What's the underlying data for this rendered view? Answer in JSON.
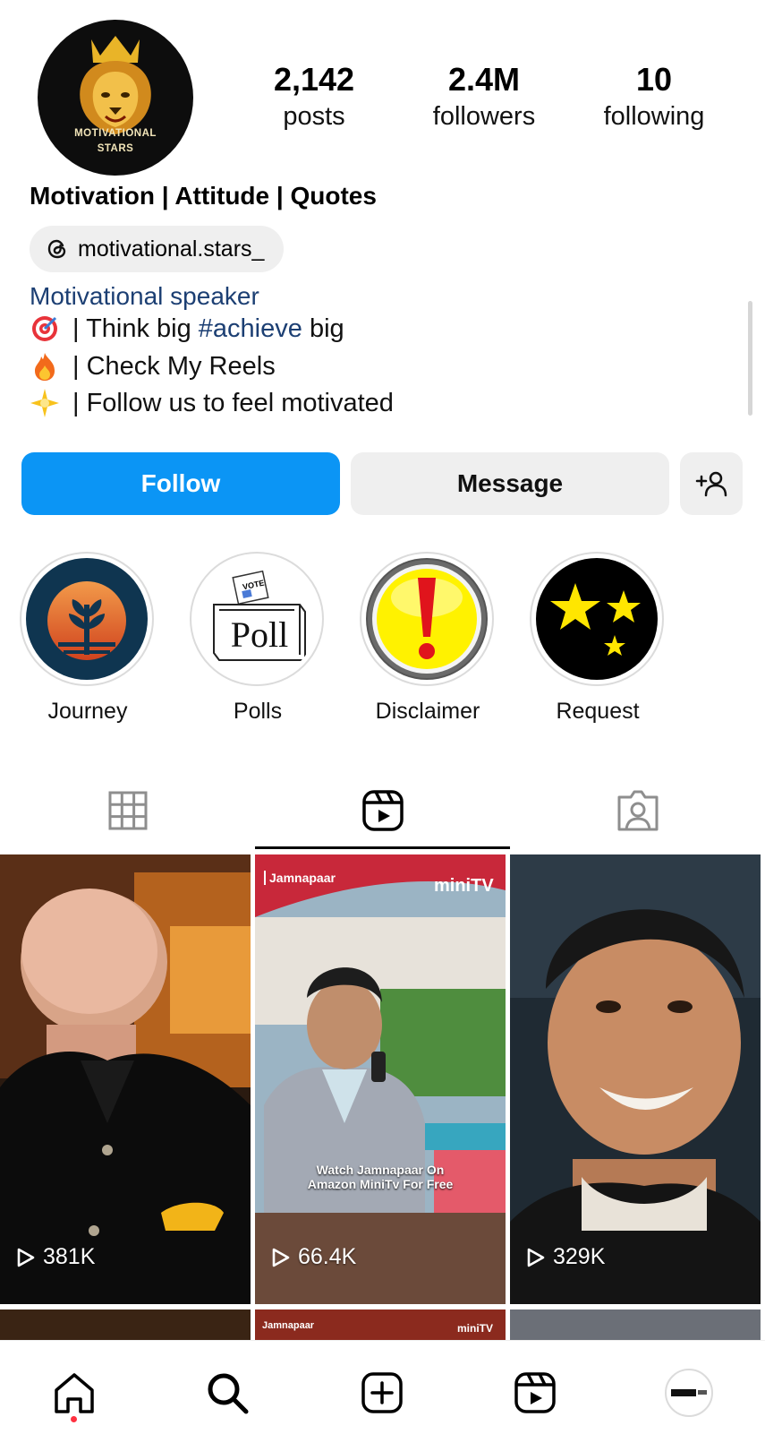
{
  "profile": {
    "avatar_text_line1": "MOTIVATIONAL",
    "avatar_text_line2": "STARS",
    "stats": [
      {
        "value": "2,142",
        "label": "posts"
      },
      {
        "value": "2.4M",
        "label": "followers"
      },
      {
        "value": "10",
        "label": "following"
      }
    ],
    "display_name": "Motivation | Attitude | Quotes",
    "threads_handle": "motivational.stars_",
    "category": "Motivational speaker",
    "bio": [
      {
        "emoji": "target-emoji",
        "pre": "| Think big ",
        "hashtag": "#achieve",
        "post": " big"
      },
      {
        "emoji": "fire-emoji",
        "pre": "| Check My Reels",
        "hashtag": "",
        "post": ""
      },
      {
        "emoji": "sparkle-emoji",
        "pre": "| Follow us to feel motivated",
        "hashtag": "",
        "post": ""
      }
    ]
  },
  "actions": {
    "follow_label": "Follow",
    "message_label": "Message"
  },
  "highlights": [
    {
      "label": "Journey"
    },
    {
      "label": "Polls",
      "image_text": "Poll",
      "badge_text": "VOTE"
    },
    {
      "label": "Disclaimer"
    },
    {
      "label": "Request"
    }
  ],
  "tabs": [
    "grid-icon",
    "reels-icon",
    "tagged-icon"
  ],
  "active_tab": "reels",
  "reels": [
    {
      "views": "381K"
    },
    {
      "views": "66.4K",
      "brand": "Jamnapaar",
      "platform": "miniTV",
      "caption": "Watch Jamnapaar On Amazon MiniTv For Free"
    },
    {
      "views": "329K"
    }
  ],
  "reels_row2": [
    {
      "brand": "Jamnapaar",
      "platform": "miniTV"
    }
  ],
  "nav": [
    "home-icon",
    "search-icon",
    "create-icon",
    "reels-icon",
    "profile-avatar"
  ],
  "colors": {
    "accent": "#0b95f5",
    "link": "#1c3f73",
    "notification": "#ff3040"
  }
}
